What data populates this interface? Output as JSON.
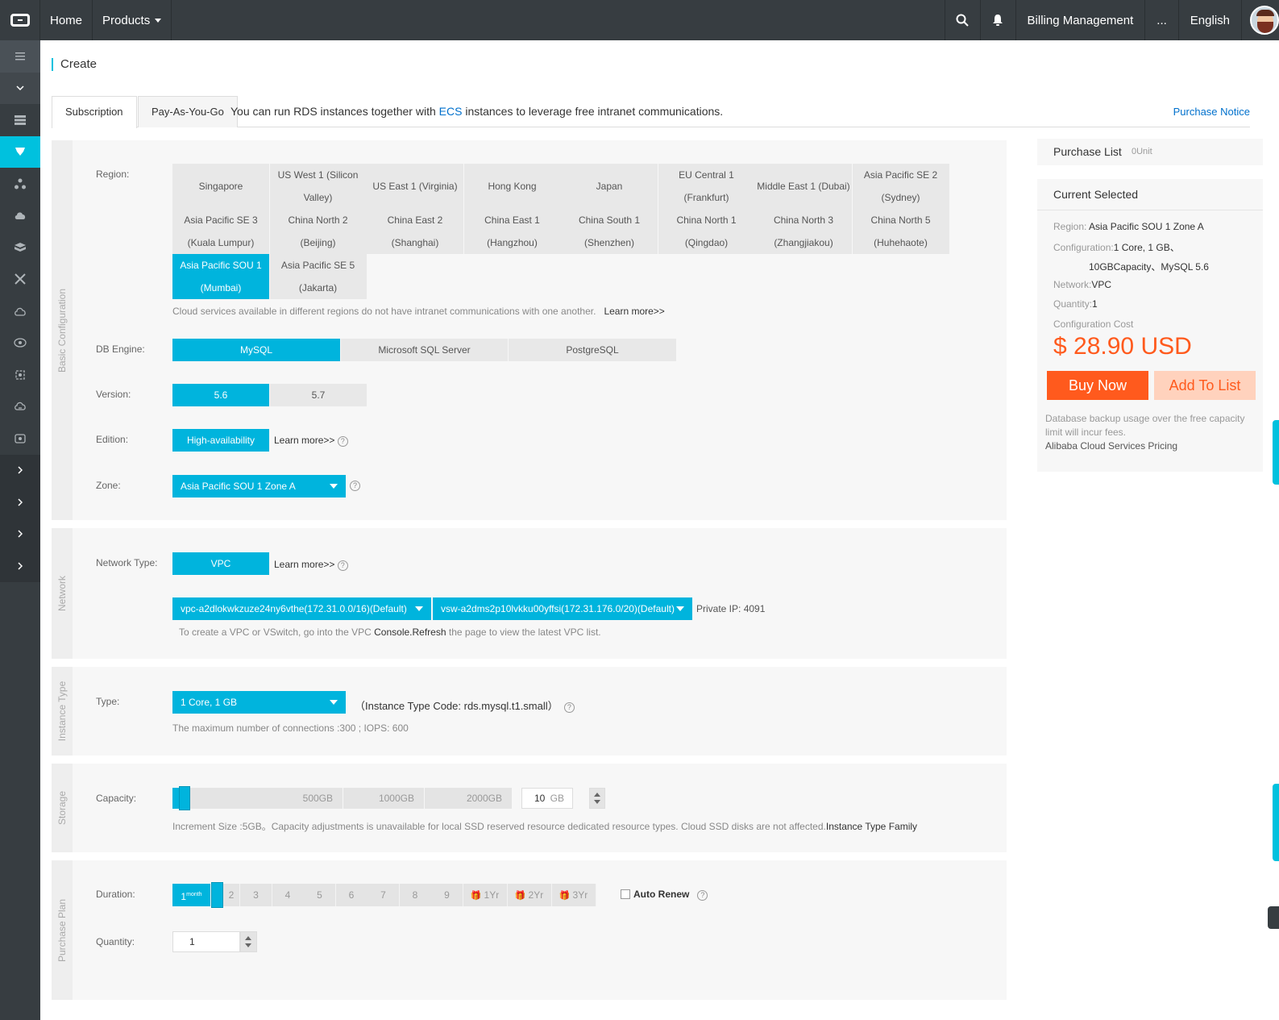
{
  "topbar": {
    "home": "Home",
    "products": "Products",
    "billing": "Billing Management",
    "more": "...",
    "language": "English"
  },
  "page": {
    "title": "Create",
    "tabs": [
      "Subscription",
      "Pay-As-You-Go"
    ],
    "notice_pre": "You can run RDS instances together with ",
    "notice_link": "ECS",
    "notice_post": " instances to leverage free intranet communications.",
    "purchase_notice": "Purchase Notice"
  },
  "basic": {
    "section_label": "Basic Configuration",
    "region_label": "Region:",
    "regions": [
      [
        "Singapore",
        "US West 1 (Silicon Valley)",
        "US East 1 (Virginia)",
        "Hong Kong",
        "Japan",
        "EU Central 1 (Frankfurt)",
        "Middle East 1 (Dubai)",
        "Asia Pacific SE 2 (Sydney)"
      ],
      [
        "Asia Pacific SE 3 (Kuala Lumpur)",
        "China North 2 (Beijing)",
        "China East 2 (Shanghai)",
        "China East 1 (Hangzhou)",
        "China South 1 (Shenzhen)",
        "China North 1 (Qingdao)",
        "China North 3 (Zhangjiakou)",
        "China North 5 (Huhehaote)"
      ],
      [
        "Asia Pacific SOU 1 (Mumbai)",
        "Asia Pacific SE 5 (Jakarta)"
      ]
    ],
    "selected_region": "Asia Pacific SOU 1 (Mumbai)",
    "region_hint": "Cloud services available in different regions do not have intranet communications with one another.",
    "learn_more_arrows": "Learn more>>",
    "db_engine_label": "DB Engine:",
    "db_engines": [
      "MySQL",
      "Microsoft SQL Server",
      "PostgreSQL"
    ],
    "version_label": "Version:",
    "versions": [
      "5.6",
      "5.7"
    ],
    "edition_label": "Edition:",
    "edition": "High-availability",
    "zone_label": "Zone:",
    "zone": "Asia Pacific SOU 1 Zone A"
  },
  "network": {
    "section_label": "Network",
    "type_label": "Network Type:",
    "type": "VPC",
    "learn_more": "Learn more>>",
    "vpc": "vpc-a2dlokwkzuze24ny6vthe(172.31.0.0/16)(Default)",
    "vswitch": "vsw-a2dms2p10lvkku00yffsi(172.31.176.0/20)(Default)",
    "private_ip": "Private IP: 4091",
    "hint_pre": "To create a VPC or VSwitch, go into the VPC ",
    "hint_console": "Console.",
    "hint_refresh": "Refresh",
    "hint_post": " the page to view the latest VPC list."
  },
  "instance": {
    "section_label": "Instance Type",
    "type_label": "Type:",
    "type": "1 Core, 1 GB",
    "code": "（Instance Type Code: rds.mysql.t1.small）",
    "hint": "The maximum number of connections :300 ; IOPS:  600"
  },
  "storage": {
    "section_label": "Storage",
    "capacity_label": "Capacity:",
    "ticks": [
      "500GB",
      "1000GB",
      "2000GB"
    ],
    "value": "10",
    "unit": "GB",
    "capacity_fraction": 0.005,
    "hint_pre": "Increment Size :5GB。Capacity adjustments is unavailable for local SSD reserved resource dedicated resource types. Cloud SSD disks are not affected.",
    "hint_link": "Instance Type Family"
  },
  "plan": {
    "section_label": "Purchase Plan",
    "duration_label": "Duration:",
    "selected_duration": "1",
    "selected_unit": "month",
    "durations": [
      "2",
      "3",
      "4",
      "5",
      "6",
      "7",
      "8",
      "9"
    ],
    "yearly": [
      "1Yr",
      "2Yr",
      "3Yr"
    ],
    "auto_renew": "Auto Renew",
    "quantity_label": "Quantity:",
    "quantity": "1"
  },
  "summary": {
    "purchase_list": "Purchase List",
    "unit": "0Unit",
    "current_selected": "Current Selected",
    "region_label": "Region:",
    "region": "Asia Pacific SOU 1 Zone A",
    "config_label": "Configuration:",
    "config_line1": "1 Core, 1 GB、",
    "config_line2": "10GBCapacity、MySQL 5.6",
    "network_label": "Network:",
    "network": "VPC",
    "quantity_label": "Quantity:",
    "quantity": "1",
    "cost_label": "Configuration Cost",
    "currency": "$",
    "cost": "28.90 USD",
    "buy_now": "Buy Now",
    "add_to_list": "Add To List",
    "note": "Database backup usage over the free capacity limit will incur fees.",
    "pricing_link": "Alibaba Cloud Services Pricing"
  },
  "colors": {
    "accent": "#00b4dd",
    "topbar": "#373d41",
    "cost": "#ff5a1d"
  }
}
